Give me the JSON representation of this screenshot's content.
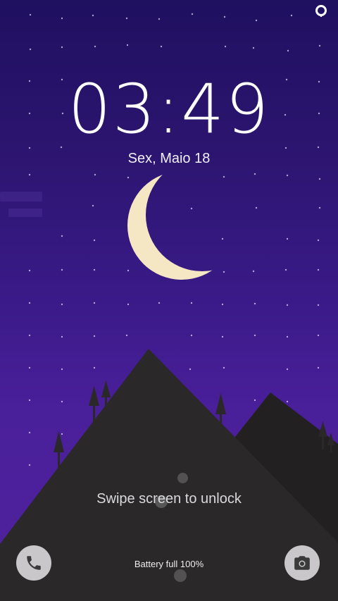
{
  "colors": {
    "sky_top": "#1f1060",
    "sky_bottom": "#50229e",
    "moon": "#f6e7c4",
    "mountain_front": "#2a2828",
    "mountain_back": "#222020",
    "button_bg": "#c9c7c9",
    "icon_dark": "#3a3a3a"
  },
  "lockscreen": {
    "time": "03:49",
    "date": "Sex, Maio 18",
    "unlock_hint": "Swipe screen to unlock",
    "battery_status": "Battery full 100%"
  },
  "icons": {
    "status": "assistant-ring-icon",
    "moon": "crescent-moon-icon",
    "phone": "phone-icon",
    "camera": "camera-icon"
  }
}
